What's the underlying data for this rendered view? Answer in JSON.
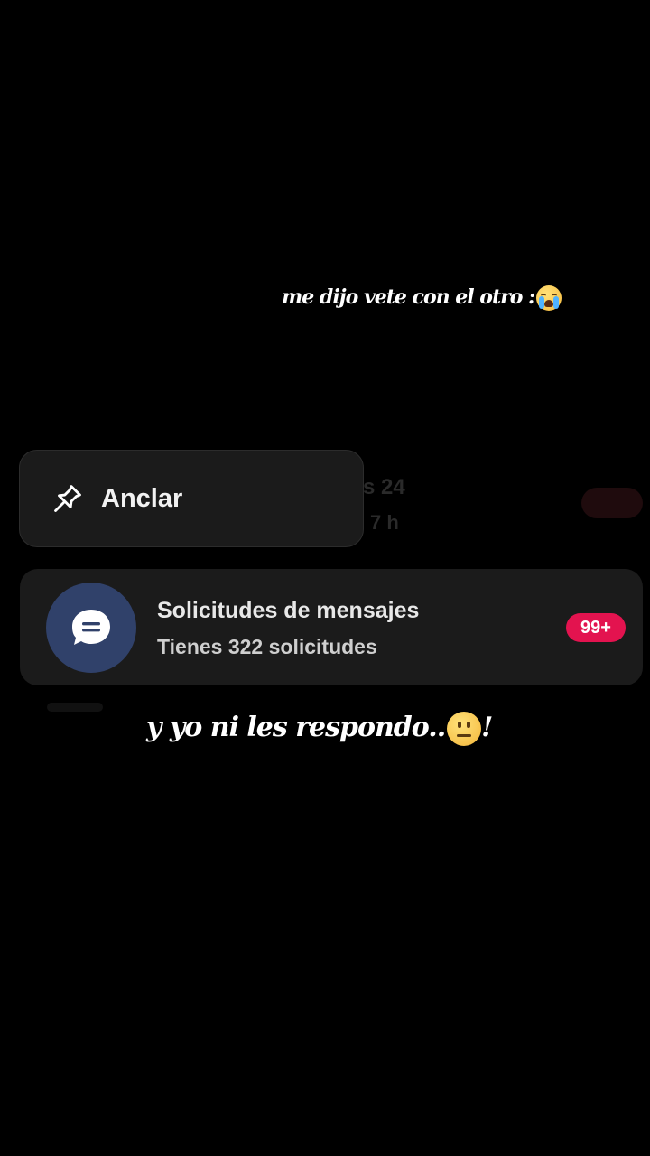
{
  "captions": {
    "top": "me dijo vete con el otro :",
    "bottom": "y yo ni  les respondo..",
    "bottom_suffix": "!"
  },
  "emojis": {
    "top": "loudly-crying-face-emoji",
    "bottom": "neutral-face-emoji"
  },
  "context_menu": {
    "pin_label": "Anclar",
    "pin_icon": "pin-icon"
  },
  "message_requests": {
    "title": "Solicitudes de mensajes",
    "subtitle": "Tienes 322 solicitudes",
    "badge": "99+",
    "icon": "chat-bubble-icon"
  },
  "colors": {
    "background": "#000000",
    "card": "#1b1b1b",
    "avatar": "#30416a",
    "badge": "#e3134f"
  }
}
